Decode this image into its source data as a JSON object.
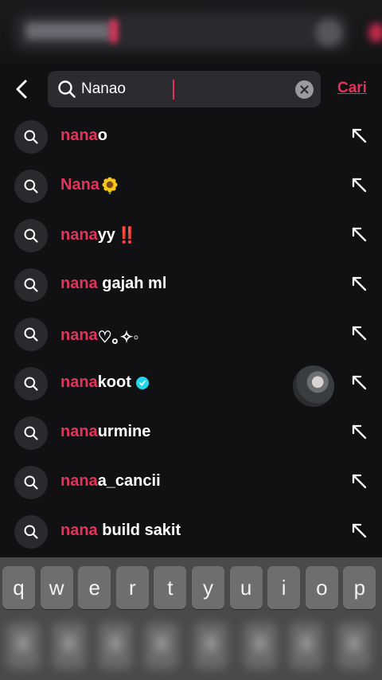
{
  "header": {
    "search_value": "Nanao",
    "search_action_label": "Cari"
  },
  "suggestions": [
    {
      "highlight": "nana",
      "rest": "o",
      "suffix": "",
      "has_avatar": false,
      "verified": false
    },
    {
      "highlight": "Nana",
      "rest": "",
      "suffix": "🌻",
      "has_avatar": false,
      "verified": false
    },
    {
      "highlight": "nana",
      "rest": "yy",
      "suffix": "‼️",
      "has_avatar": false,
      "verified": false
    },
    {
      "highlight": "nana",
      "rest": " gajah ml",
      "suffix": "",
      "has_avatar": false,
      "verified": false
    },
    {
      "highlight": "nana",
      "rest": "♡｡✧◦",
      "suffix": "",
      "has_avatar": false,
      "verified": false
    },
    {
      "highlight": "nana",
      "rest": "koot",
      "suffix": "",
      "has_avatar": true,
      "verified": true
    },
    {
      "highlight": "nana",
      "rest": "urmine",
      "suffix": "",
      "has_avatar": false,
      "verified": false
    },
    {
      "highlight": "nana",
      "rest": "a_cancii",
      "suffix": "",
      "has_avatar": false,
      "verified": false
    },
    {
      "highlight": "nana",
      "rest": " build sakit",
      "suffix": "",
      "has_avatar": false,
      "verified": false
    }
  ],
  "keyboard": {
    "row1": [
      "q",
      "w",
      "e",
      "r",
      "t",
      "y",
      "u",
      "i",
      "o",
      "p"
    ]
  },
  "colors": {
    "accent": "#e2335a",
    "background": "#111113",
    "verified": "#20d5ec"
  },
  "icons": {
    "back": "chevron-left-icon",
    "search": "search-icon",
    "clear": "clear-x-icon",
    "fill": "arrow-up-left-icon",
    "verified": "verified-check-icon"
  }
}
